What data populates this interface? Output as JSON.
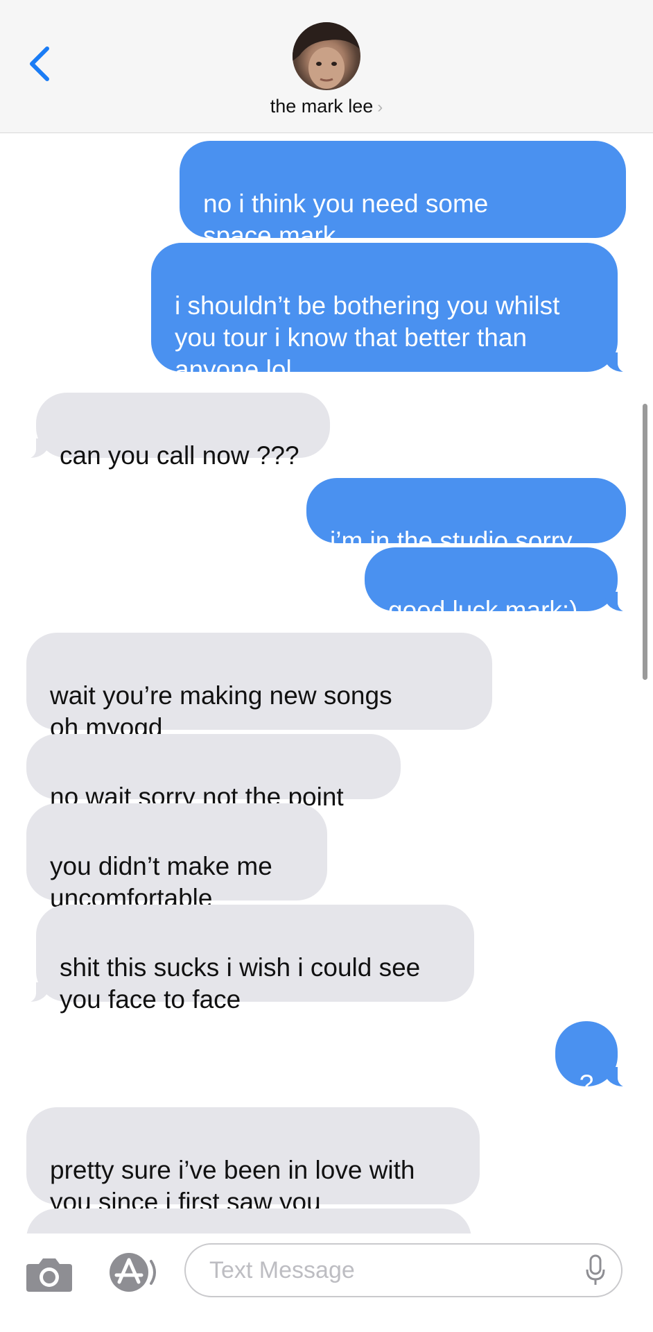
{
  "header": {
    "contact_name": "the mark lee",
    "chevron": "›"
  },
  "messages": [
    {
      "from": "me",
      "text": "no i think you need some\nspace mark"
    },
    {
      "from": "me",
      "text": "i shouldn’t be bothering you whilst\nyou tour i know that better than\nanyone lol"
    },
    {
      "from": "them",
      "text": "can you call now ???"
    },
    {
      "from": "me",
      "text": "i’m in the studio sorry"
    },
    {
      "from": "me",
      "text": "good luck mark:)"
    },
    {
      "from": "them",
      "text": "wait you’re making new songs\noh myogd"
    },
    {
      "from": "them",
      "text": "no wait sorry not the point"
    },
    {
      "from": "them",
      "text": "you didn’t make me\nuncomfortable"
    },
    {
      "from": "them",
      "text": "shit this sucks i wish i could see\nyou face to face"
    },
    {
      "from": "me",
      "text": "?"
    },
    {
      "from": "them",
      "text": "pretty sure i’ve been in love with\nyou since i first saw you"
    }
  ],
  "composer": {
    "placeholder": "Text Message"
  },
  "icons": [
    "back-chevron-icon",
    "camera-icon",
    "app-store-icon",
    "microphone-icon"
  ],
  "colors": {
    "outgoing_bubble": "#4a91f0",
    "incoming_bubble": "#e5e5ea",
    "accent": "#1a7cf5"
  }
}
